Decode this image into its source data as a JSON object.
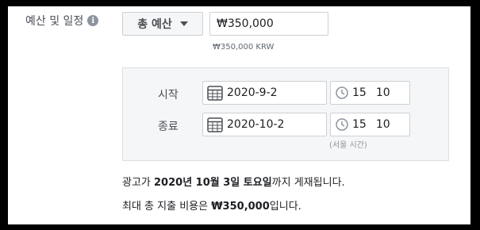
{
  "section": {
    "label": "예산 및 일정",
    "info_icon": "info-icon"
  },
  "budget": {
    "type_label": "총 예산",
    "amount": "₩350,000",
    "note": "₩350,000 KRW"
  },
  "schedule": {
    "start_label": "시작",
    "start_date": "2020-9-2",
    "start_hour": "15",
    "start_minute": "10",
    "end_label": "종료",
    "end_date": "2020-10-2",
    "end_hour": "15",
    "end_minute": "10",
    "timezone_note": "(서울 시간)",
    "icons": {
      "date": "calendar-icon",
      "time": "clock-icon"
    }
  },
  "summary": {
    "line1_prefix": "광고가 ",
    "line1_date": "2020년 10월 3일 토요일",
    "line1_suffix": "까지 게재됩니다.",
    "line2_prefix": "최대 총 지출 비용은 ",
    "line2_amount": "₩350,000",
    "line2_suffix": "입니다."
  }
}
